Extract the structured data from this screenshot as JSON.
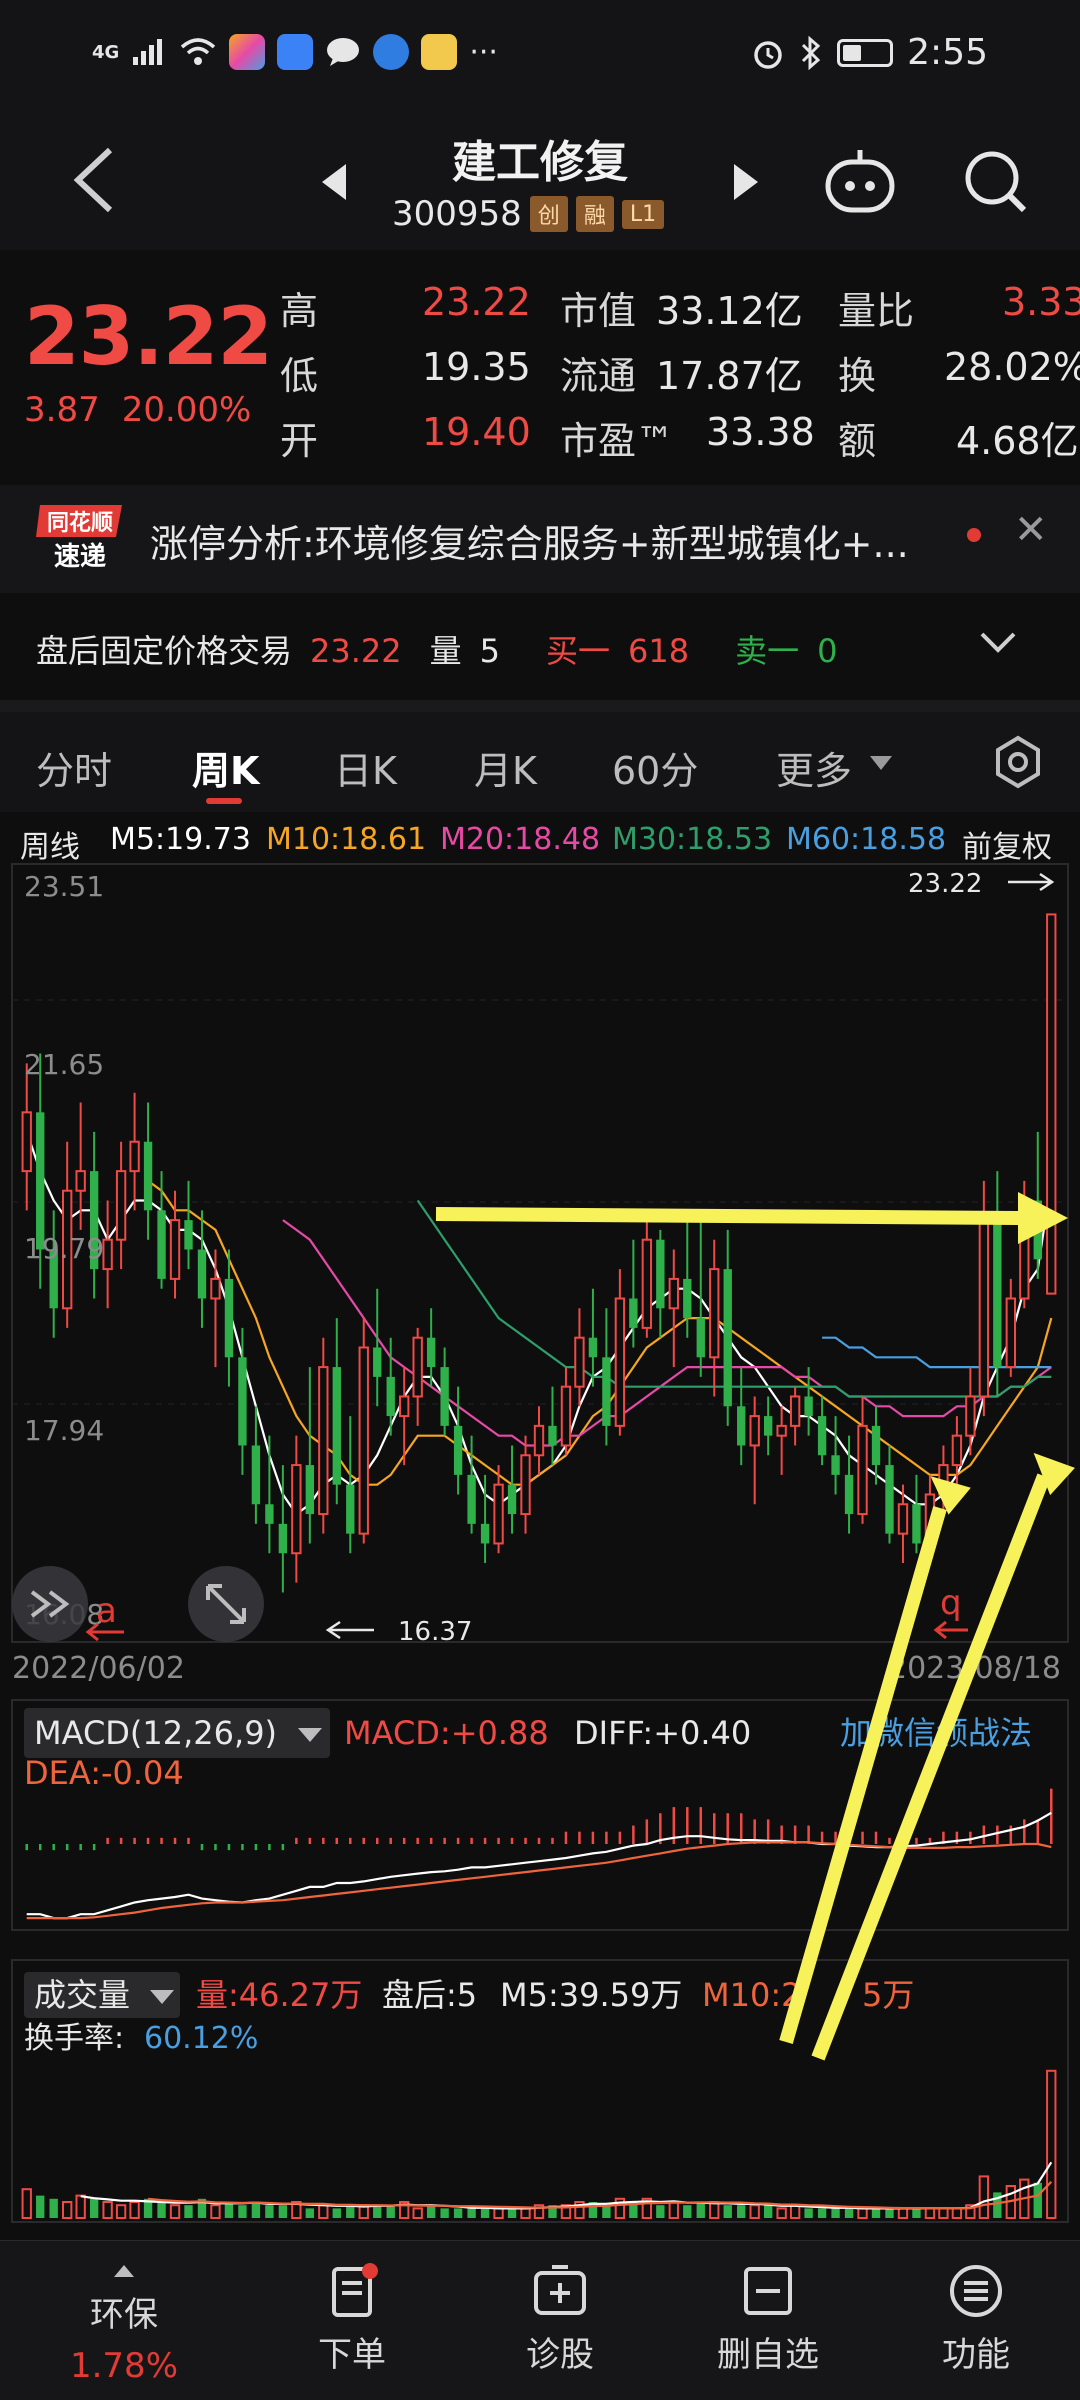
{
  "status_bar": {
    "network": "4G",
    "time": "2:55",
    "more": "···"
  },
  "header": {
    "stock_name": "建工修复",
    "stock_code": "300958",
    "tags": [
      "创",
      "融",
      "L1"
    ]
  },
  "quote": {
    "price": "23.22",
    "change": "3.87",
    "change_pct": "20.00%",
    "high_label": "高",
    "high": "23.22",
    "low_label": "低",
    "low": "19.35",
    "open_label": "开",
    "open": "19.40",
    "mktcap_label": "市值",
    "mktcap": "33.12亿",
    "float_label": "流通",
    "float": "17.87亿",
    "pe_label": "市盈™",
    "pe": "33.38",
    "volratio_label": "量比",
    "volratio": "3.33",
    "turnover_label": "换",
    "turnover": "28.02%",
    "amount_label": "额",
    "amount": "4.68亿"
  },
  "news": {
    "logo_top": "同花顺",
    "logo_bottom": "速递",
    "text": "涨停分析:环境修复综合服务+新型城镇化+..."
  },
  "after_hours": {
    "label": "盘后固定价格交易",
    "price": "23.22",
    "vol_label": "量",
    "vol": "5",
    "buy1_label": "买一",
    "buy1": "618",
    "sell1_label": "卖一",
    "sell1": "0"
  },
  "tabs": [
    "分时",
    "周K",
    "日K",
    "月K",
    "60分",
    "更多"
  ],
  "ma_row": {
    "period": "周线",
    "m5": "M5:19.73",
    "m10": "M10:18.61",
    "m20": "M20:18.48",
    "m30": "M30:18.53",
    "m60": "M60:18.58",
    "adjust": "前复权"
  },
  "colors": {
    "up": "#f04a45",
    "down": "#2fb04a",
    "m5": "#ffffff",
    "m10": "#f5a623",
    "m20": "#e64aa7",
    "m30": "#2e9e6a",
    "m60": "#4a9fe0",
    "arrow": "#f7f25a"
  },
  "chart_data": [
    {
      "type": "candlestick",
      "title": "周K",
      "y_ticks": [
        "23.51",
        "21.65",
        "19.79",
        "17.94",
        "16.08"
      ],
      "ylim": [
        16.08,
        23.51
      ],
      "x_start": "2022/06/02",
      "x_end": "2023/08/18",
      "high_marker": "23.22",
      "low_marker": "16.37",
      "left_marker": "a",
      "right_marker": "q",
      "candles": [
        [
          20.6,
          21.7,
          20.2,
          21.2
        ],
        [
          21.2,
          21.8,
          19.4,
          19.8
        ],
        [
          19.8,
          20.2,
          18.9,
          19.2
        ],
        [
          19.2,
          20.9,
          19.0,
          20.4
        ],
        [
          20.4,
          21.3,
          20.0,
          20.6
        ],
        [
          20.6,
          21.0,
          19.3,
          19.6
        ],
        [
          19.6,
          20.3,
          19.2,
          19.9
        ],
        [
          19.9,
          20.9,
          19.6,
          20.6
        ],
        [
          20.6,
          21.4,
          20.2,
          20.9
        ],
        [
          20.9,
          21.3,
          19.9,
          20.2
        ],
        [
          20.2,
          20.6,
          19.4,
          19.5
        ],
        [
          19.5,
          20.4,
          19.3,
          20.1
        ],
        [
          20.1,
          20.5,
          19.6,
          19.8
        ],
        [
          19.8,
          20.2,
          19.0,
          19.3
        ],
        [
          19.3,
          19.8,
          18.6,
          19.5
        ],
        [
          19.5,
          19.8,
          18.4,
          18.7
        ],
        [
          18.7,
          19.0,
          17.5,
          17.8
        ],
        [
          17.8,
          18.2,
          17.0,
          17.2
        ],
        [
          17.2,
          17.9,
          16.7,
          17.0
        ],
        [
          17.0,
          17.6,
          16.3,
          16.7
        ],
        [
          16.7,
          17.9,
          16.4,
          17.6
        ],
        [
          17.6,
          18.6,
          16.8,
          17.1
        ],
        [
          17.1,
          18.9,
          16.9,
          18.6
        ],
        [
          18.6,
          19.1,
          17.2,
          17.4
        ],
        [
          17.4,
          18.1,
          16.7,
          16.9
        ],
        [
          16.9,
          19.1,
          16.8,
          18.8
        ],
        [
          18.8,
          19.4,
          18.2,
          18.5
        ],
        [
          18.5,
          18.9,
          17.9,
          18.1
        ],
        [
          18.1,
          18.6,
          17.6,
          18.3
        ],
        [
          18.3,
          19.0,
          18.0,
          18.9
        ],
        [
          18.9,
          19.2,
          18.4,
          18.6
        ],
        [
          18.6,
          18.8,
          17.9,
          18.0
        ],
        [
          18.0,
          18.4,
          17.3,
          17.5
        ],
        [
          17.5,
          17.9,
          16.9,
          17.0
        ],
        [
          17.0,
          17.5,
          16.6,
          16.8
        ],
        [
          16.8,
          17.6,
          16.7,
          17.4
        ],
        [
          17.4,
          17.8,
          16.9,
          17.1
        ],
        [
          17.1,
          17.9,
          16.9,
          17.7
        ],
        [
          17.7,
          18.2,
          17.5,
          18.0
        ],
        [
          18.0,
          18.4,
          17.6,
          17.8
        ],
        [
          17.8,
          18.6,
          17.7,
          18.4
        ],
        [
          18.4,
          19.2,
          18.2,
          18.9
        ],
        [
          18.9,
          19.4,
          18.4,
          18.7
        ],
        [
          18.7,
          19.2,
          17.8,
          18.0
        ],
        [
          18.0,
          19.6,
          17.9,
          19.3
        ],
        [
          19.3,
          19.9,
          18.8,
          19.0
        ],
        [
          19.0,
          20.2,
          18.9,
          19.9
        ],
        [
          19.9,
          20.0,
          18.9,
          19.2
        ],
        [
          19.2,
          19.8,
          18.6,
          19.5
        ],
        [
          19.5,
          20.1,
          18.9,
          19.1
        ],
        [
          19.1,
          20.2,
          18.5,
          18.7
        ],
        [
          18.7,
          19.9,
          18.3,
          19.6
        ],
        [
          19.6,
          20.0,
          18.0,
          18.2
        ],
        [
          18.2,
          18.6,
          17.6,
          17.8
        ],
        [
          17.8,
          18.3,
          17.2,
          18.1
        ],
        [
          18.1,
          18.3,
          17.7,
          17.9
        ],
        [
          17.9,
          18.2,
          17.5,
          18.0
        ],
        [
          18.0,
          18.4,
          17.8,
          18.3
        ],
        [
          18.3,
          18.6,
          17.9,
          18.1
        ],
        [
          18.1,
          18.3,
          17.6,
          17.7
        ],
        [
          17.7,
          18.1,
          17.3,
          17.5
        ],
        [
          17.5,
          17.9,
          16.9,
          17.1
        ],
        [
          17.1,
          18.3,
          17.0,
          18.0
        ],
        [
          18.0,
          18.2,
          17.4,
          17.6
        ],
        [
          17.6,
          17.8,
          16.8,
          16.9
        ],
        [
          16.9,
          17.4,
          16.6,
          17.2
        ],
        [
          17.2,
          17.5,
          16.7,
          16.8
        ],
        [
          16.8,
          17.5,
          16.7,
          17.3
        ],
        [
          17.3,
          17.8,
          17.1,
          17.6
        ],
        [
          17.6,
          18.1,
          17.3,
          17.9
        ],
        [
          17.9,
          18.6,
          17.7,
          18.3
        ],
        [
          18.3,
          20.5,
          18.1,
          20.1
        ],
        [
          20.1,
          20.6,
          18.3,
          18.6
        ],
        [
          18.6,
          19.5,
          18.5,
          19.3
        ],
        [
          19.3,
          20.5,
          19.2,
          20.3
        ],
        [
          20.3,
          21.0,
          19.5,
          19.7
        ],
        [
          19.35,
          23.22,
          19.35,
          23.22
        ]
      ],
      "ma": {
        "M5": [
          21.0,
          20.6,
          20.3,
          20.1,
          20.2,
          20.2,
          19.9,
          20.1,
          20.3,
          20.3,
          20.2,
          20.0,
          20.0,
          19.9,
          19.6,
          19.2,
          18.7,
          18.2,
          17.7,
          17.3,
          17.1,
          17.2,
          17.4,
          17.5,
          17.4,
          17.5,
          17.7,
          18.0,
          18.3,
          18.5,
          18.5,
          18.3,
          18.0,
          17.6,
          17.3,
          17.2,
          17.3,
          17.4,
          17.5,
          17.6,
          17.8,
          18.2,
          18.5,
          18.6,
          18.8,
          19.0,
          19.2,
          19.3,
          19.4,
          19.4,
          19.3,
          19.1,
          18.9,
          18.7,
          18.6,
          18.4,
          18.2,
          18.1,
          18.1,
          18.0,
          17.9,
          17.7,
          17.6,
          17.5,
          17.4,
          17.3,
          17.2,
          17.2,
          17.3,
          17.5,
          17.8,
          18.3,
          18.6,
          18.9,
          19.4,
          19.6,
          20.5
        ],
        "M10": [
          null,
          null,
          null,
          null,
          null,
          null,
          null,
          null,
          null,
          20.5,
          20.4,
          20.2,
          20.2,
          20.1,
          20.0,
          19.7,
          19.4,
          19.1,
          18.7,
          18.4,
          18.1,
          17.9,
          17.8,
          17.7,
          17.5,
          17.4,
          17.4,
          17.5,
          17.7,
          17.9,
          17.9,
          17.9,
          17.8,
          17.7,
          17.6,
          17.5,
          17.4,
          17.4,
          17.5,
          17.6,
          17.7,
          17.9,
          18.1,
          18.2,
          18.4,
          18.6,
          18.8,
          18.9,
          19.0,
          19.1,
          19.1,
          19.1,
          19.0,
          18.9,
          18.8,
          18.7,
          18.6,
          18.5,
          18.4,
          18.3,
          18.2,
          18.1,
          18.0,
          17.9,
          17.8,
          17.7,
          17.6,
          17.5,
          17.5,
          17.5,
          17.6,
          17.8,
          18.0,
          18.2,
          18.4,
          18.6,
          19.1
        ],
        "M20": [
          null,
          null,
          null,
          null,
          null,
          null,
          null,
          null,
          null,
          null,
          null,
          null,
          null,
          null,
          null,
          null,
          null,
          null,
          null,
          20.1,
          20.0,
          19.9,
          19.7,
          19.5,
          19.3,
          19.1,
          18.9,
          18.7,
          18.6,
          18.5,
          18.4,
          18.3,
          18.2,
          18.1,
          18.0,
          17.9,
          17.9,
          17.8,
          17.8,
          17.8,
          17.9,
          17.9,
          18.0,
          18.1,
          18.1,
          18.2,
          18.3,
          18.4,
          18.5,
          18.6,
          18.6,
          18.6,
          18.6,
          18.6,
          18.6,
          18.6,
          18.6,
          18.5,
          18.5,
          18.4,
          18.4,
          18.3,
          18.3,
          18.2,
          18.2,
          18.1,
          18.1,
          18.1,
          18.1,
          18.2,
          18.2,
          18.3,
          18.3,
          18.4,
          18.4,
          18.5,
          18.6
        ],
        "M30": [
          null,
          null,
          null,
          null,
          null,
          null,
          null,
          null,
          null,
          null,
          null,
          null,
          null,
          null,
          null,
          null,
          null,
          null,
          null,
          null,
          null,
          null,
          null,
          null,
          null,
          null,
          null,
          null,
          null,
          20.3,
          20.1,
          19.9,
          19.7,
          19.5,
          19.3,
          19.1,
          19.0,
          18.9,
          18.8,
          18.7,
          18.6,
          18.6,
          18.5,
          18.5,
          18.4,
          18.4,
          18.4,
          18.4,
          18.4,
          18.4,
          18.4,
          18.4,
          18.4,
          18.4,
          18.4,
          18.4,
          18.4,
          18.4,
          18.4,
          18.4,
          18.4,
          18.3,
          18.3,
          18.3,
          18.3,
          18.3,
          18.3,
          18.3,
          18.3,
          18.3,
          18.3,
          18.3,
          18.3,
          18.4,
          18.4,
          18.5,
          18.5
        ],
        "M60": [
          null,
          null,
          null,
          null,
          null,
          null,
          null,
          null,
          null,
          null,
          null,
          null,
          null,
          null,
          null,
          null,
          null,
          null,
          null,
          null,
          null,
          null,
          null,
          null,
          null,
          null,
          null,
          null,
          null,
          null,
          null,
          null,
          null,
          null,
          null,
          null,
          null,
          null,
          null,
          null,
          null,
          null,
          null,
          null,
          null,
          null,
          null,
          null,
          null,
          null,
          null,
          null,
          null,
          null,
          null,
          null,
          null,
          null,
          null,
          18.9,
          18.9,
          18.8,
          18.8,
          18.7,
          18.7,
          18.7,
          18.7,
          18.6,
          18.6,
          18.6,
          18.6,
          18.6,
          18.6,
          18.6,
          18.6,
          18.6,
          18.6
        ]
      }
    },
    {
      "type": "bar",
      "title": "MACD(12,26,9)",
      "macd_label": "MACD:+0.88",
      "diff_label": "DIFF:+0.40",
      "dea_label": "DEA:-0.04",
      "link": "加微信领战法",
      "ylim": [
        -1.2,
        1.2
      ],
      "values": [
        -0.1,
        -0.1,
        -0.1,
        -0.1,
        -0.1,
        -0.1,
        0.1,
        0.1,
        0.1,
        0.1,
        0.1,
        0.1,
        0.1,
        -0.1,
        -0.1,
        -0.1,
        -0.1,
        -0.1,
        -0.1,
        -0.1,
        0.1,
        0.1,
        0.1,
        0.1,
        0.1,
        0.1,
        0.1,
        0.1,
        0.1,
        0.1,
        0.1,
        0.1,
        0.1,
        0.1,
        0.1,
        0.1,
        0.1,
        0.1,
        0.1,
        0.1,
        0.2,
        0.2,
        0.2,
        0.2,
        0.2,
        0.3,
        0.4,
        0.5,
        0.6,
        0.6,
        0.6,
        0.5,
        0.5,
        0.5,
        0.4,
        0.4,
        0.3,
        0.3,
        0.3,
        0.2,
        0.2,
        0.2,
        0.2,
        0.2,
        0.1,
        0.1,
        0.1,
        0.1,
        0.2,
        0.2,
        0.2,
        0.3,
        0.3,
        0.3,
        0.4,
        0.4,
        0.9
      ],
      "diff": [
        -0.9,
        -0.9,
        -0.95,
        -0.95,
        -0.9,
        -0.9,
        -0.85,
        -0.8,
        -0.75,
        -0.72,
        -0.7,
        -0.68,
        -0.65,
        -0.7,
        -0.72,
        -0.74,
        -0.75,
        -0.72,
        -0.7,
        -0.65,
        -0.6,
        -0.55,
        -0.55,
        -0.5,
        -0.5,
        -0.48,
        -0.45,
        -0.42,
        -0.4,
        -0.38,
        -0.36,
        -0.35,
        -0.33,
        -0.3,
        -0.3,
        -0.28,
        -0.26,
        -0.24,
        -0.22,
        -0.2,
        -0.18,
        -0.15,
        -0.12,
        -0.1,
        -0.06,
        -0.02,
        0.0,
        0.05,
        0.08,
        0.1,
        0.1,
        0.08,
        0.06,
        0.05,
        0.05,
        0.04,
        0.04,
        0.02,
        0.02,
        0.0,
        0.0,
        -0.02,
        -0.03,
        -0.04,
        -0.04,
        -0.03,
        -0.02,
        0.0,
        0.02,
        0.04,
        0.06,
        0.1,
        0.14,
        0.18,
        0.22,
        0.3,
        0.4
      ],
      "dea": [
        -0.95,
        -0.95,
        -0.95,
        -0.95,
        -0.95,
        -0.94,
        -0.92,
        -0.9,
        -0.88,
        -0.85,
        -0.82,
        -0.8,
        -0.78,
        -0.76,
        -0.75,
        -0.75,
        -0.75,
        -0.74,
        -0.73,
        -0.72,
        -0.7,
        -0.68,
        -0.66,
        -0.64,
        -0.62,
        -0.6,
        -0.58,
        -0.56,
        -0.54,
        -0.52,
        -0.5,
        -0.48,
        -0.46,
        -0.44,
        -0.42,
        -0.4,
        -0.38,
        -0.36,
        -0.34,
        -0.32,
        -0.3,
        -0.28,
        -0.26,
        -0.24,
        -0.21,
        -0.18,
        -0.15,
        -0.12,
        -0.09,
        -0.06,
        -0.04,
        -0.02,
        0.0,
        0.01,
        0.02,
        0.02,
        0.02,
        0.02,
        0.02,
        0.01,
        0.0,
        -0.01,
        -0.02,
        -0.03,
        -0.04,
        -0.05,
        -0.05,
        -0.05,
        -0.05,
        -0.04,
        -0.04,
        -0.03,
        -0.02,
        -0.01,
        0.0,
        0.0,
        -0.04
      ]
    },
    {
      "type": "bar",
      "title": "成交量",
      "vol_label": "量:46.27万",
      "afterhours_label": "盘后:5",
      "m5_label": "M5:39.59万",
      "m10_label": "M10:2",
      "m10_suffix": "5万",
      "turnover_label": "换手率:",
      "turnover_value": "60.12%",
      "ylim": [
        0,
        50
      ],
      "values": [
        9,
        7,
        6,
        5,
        7,
        6,
        5,
        4,
        5,
        6,
        5,
        4,
        4,
        6,
        4,
        5,
        4,
        5,
        4,
        4,
        5,
        3,
        4,
        3,
        4,
        4,
        4,
        4,
        5,
        3,
        4,
        3,
        3,
        3,
        3,
        3,
        3,
        3,
        4,
        4,
        4,
        5,
        5,
        4,
        6,
        5,
        6,
        4,
        5,
        4,
        5,
        5,
        4,
        4,
        4,
        4,
        3,
        4,
        3,
        3,
        3,
        3,
        3,
        3,
        3,
        3,
        3,
        3,
        3,
        3,
        4,
        13,
        8,
        10,
        12,
        11,
        46
      ]
    }
  ],
  "bottom_bar": {
    "sector_label": "环保",
    "sector_pct": "1.78%",
    "order": "下单",
    "diagnose": "诊股",
    "remove": "删自选",
    "function": "功能"
  }
}
